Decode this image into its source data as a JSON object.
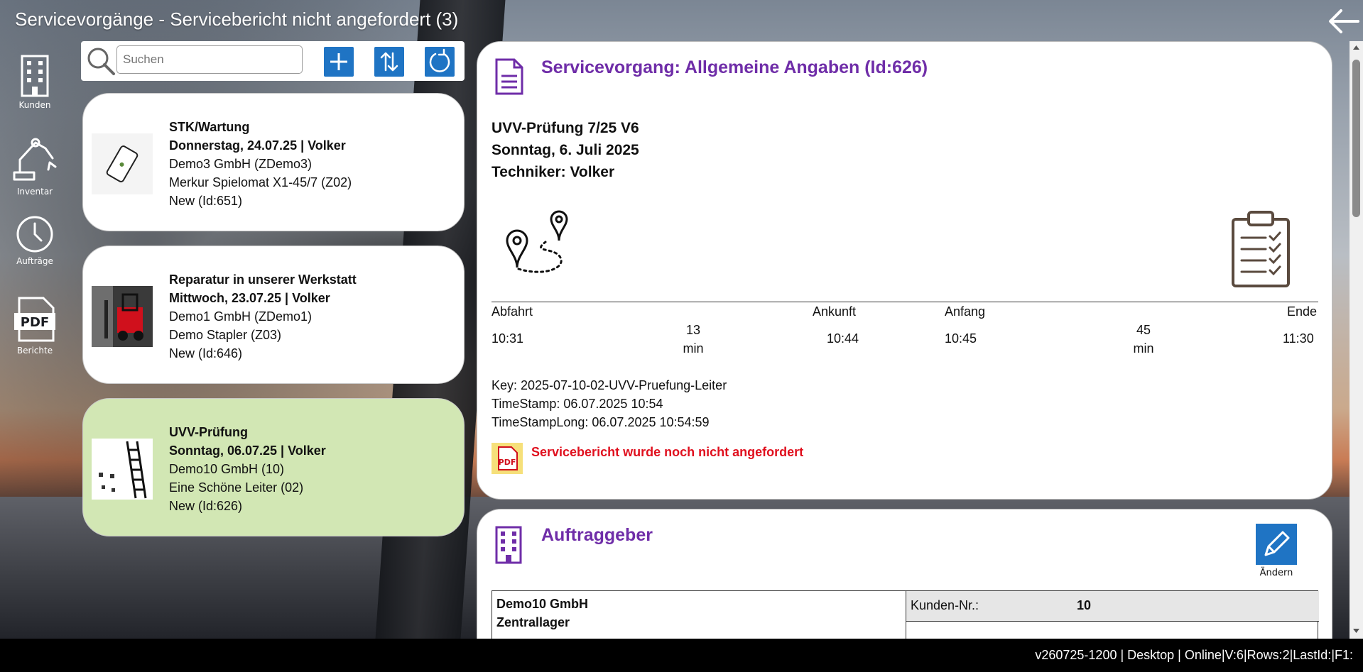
{
  "window": {
    "title": "Servicevorgänge - Servicebericht nicht angefordert (3)"
  },
  "nav": {
    "items": [
      {
        "label": "Kunden",
        "icon": "building-icon"
      },
      {
        "label": "Inventar",
        "icon": "robot-arm-icon"
      },
      {
        "label": "Aufträge",
        "icon": "clock-icon"
      },
      {
        "label": "Berichte",
        "icon": "pdf-icon"
      }
    ]
  },
  "search": {
    "placeholder": "Suchen",
    "value": ""
  },
  "list": {
    "items": [
      {
        "title": "STK/Wartung",
        "date": "Donnerstag, 24.07.25 | Volker",
        "customer": "Demo3 GmbH (ZDemo3)",
        "device": "Merkur Spielomat X1-45/7 (Z02)",
        "status": "New (Id:651)"
      },
      {
        "title": "Reparatur in unserer Werkstatt",
        "date": "Mittwoch, 23.07.25 | Volker",
        "customer": "Demo1 GmbH (ZDemo1)",
        "device": "Demo Stapler (Z03)",
        "status": "New (Id:646)"
      },
      {
        "title": "UVV-Prüfung",
        "date": "Sonntag, 06.07.25 | Volker",
        "customer": "Demo10 GmbH (10)",
        "device": "Eine Schöne Leiter (02)",
        "status": "New (Id:626)"
      }
    ]
  },
  "detail": {
    "section_title": "Servicevorgang: Allgemeine Angaben  (Id:626)",
    "job": "UVV-Prüfung 7/25 V6",
    "date": "Sonntag, 6. Juli 2025",
    "technician": "Techniker: Volker",
    "times": {
      "abfahrt_label": "Abfahrt",
      "ankunft_label": "Ankunft",
      "anfang_label": "Anfang",
      "ende_label": "Ende",
      "abfahrt": "10:31",
      "travel_minutes": "13",
      "travel_unit": "min",
      "ankunft": "10:44",
      "anfang": "10:45",
      "work_minutes": "45",
      "work_unit": "min",
      "ende": "11:30"
    },
    "key": "Key: 2025-07-10-02-UVV-Pruefung-Leiter",
    "timestamp": "TimeStamp: 06.07.2025 10:54",
    "timestamp_long": "TimeStampLong: 06.07.2025 10:54:59",
    "warning": "Servicebericht wurde noch nicht angefordert"
  },
  "customer_section": {
    "title": "Auftraggeber",
    "edit_label": "Ändern",
    "name": "Demo10 GmbH",
    "location": "Zentrallager",
    "kunden_nr_label": "Kunden-Nr.:",
    "kunden_nr": "10"
  },
  "statusbar": {
    "text": "v260725-1200 | Desktop | Online|V:6|Rows:2|LastId:|F1:"
  },
  "colors": {
    "accent": "#6f2da8",
    "button": "#1f74c4",
    "selected_card": "#d2e7b4",
    "warning": "#e0101e"
  }
}
